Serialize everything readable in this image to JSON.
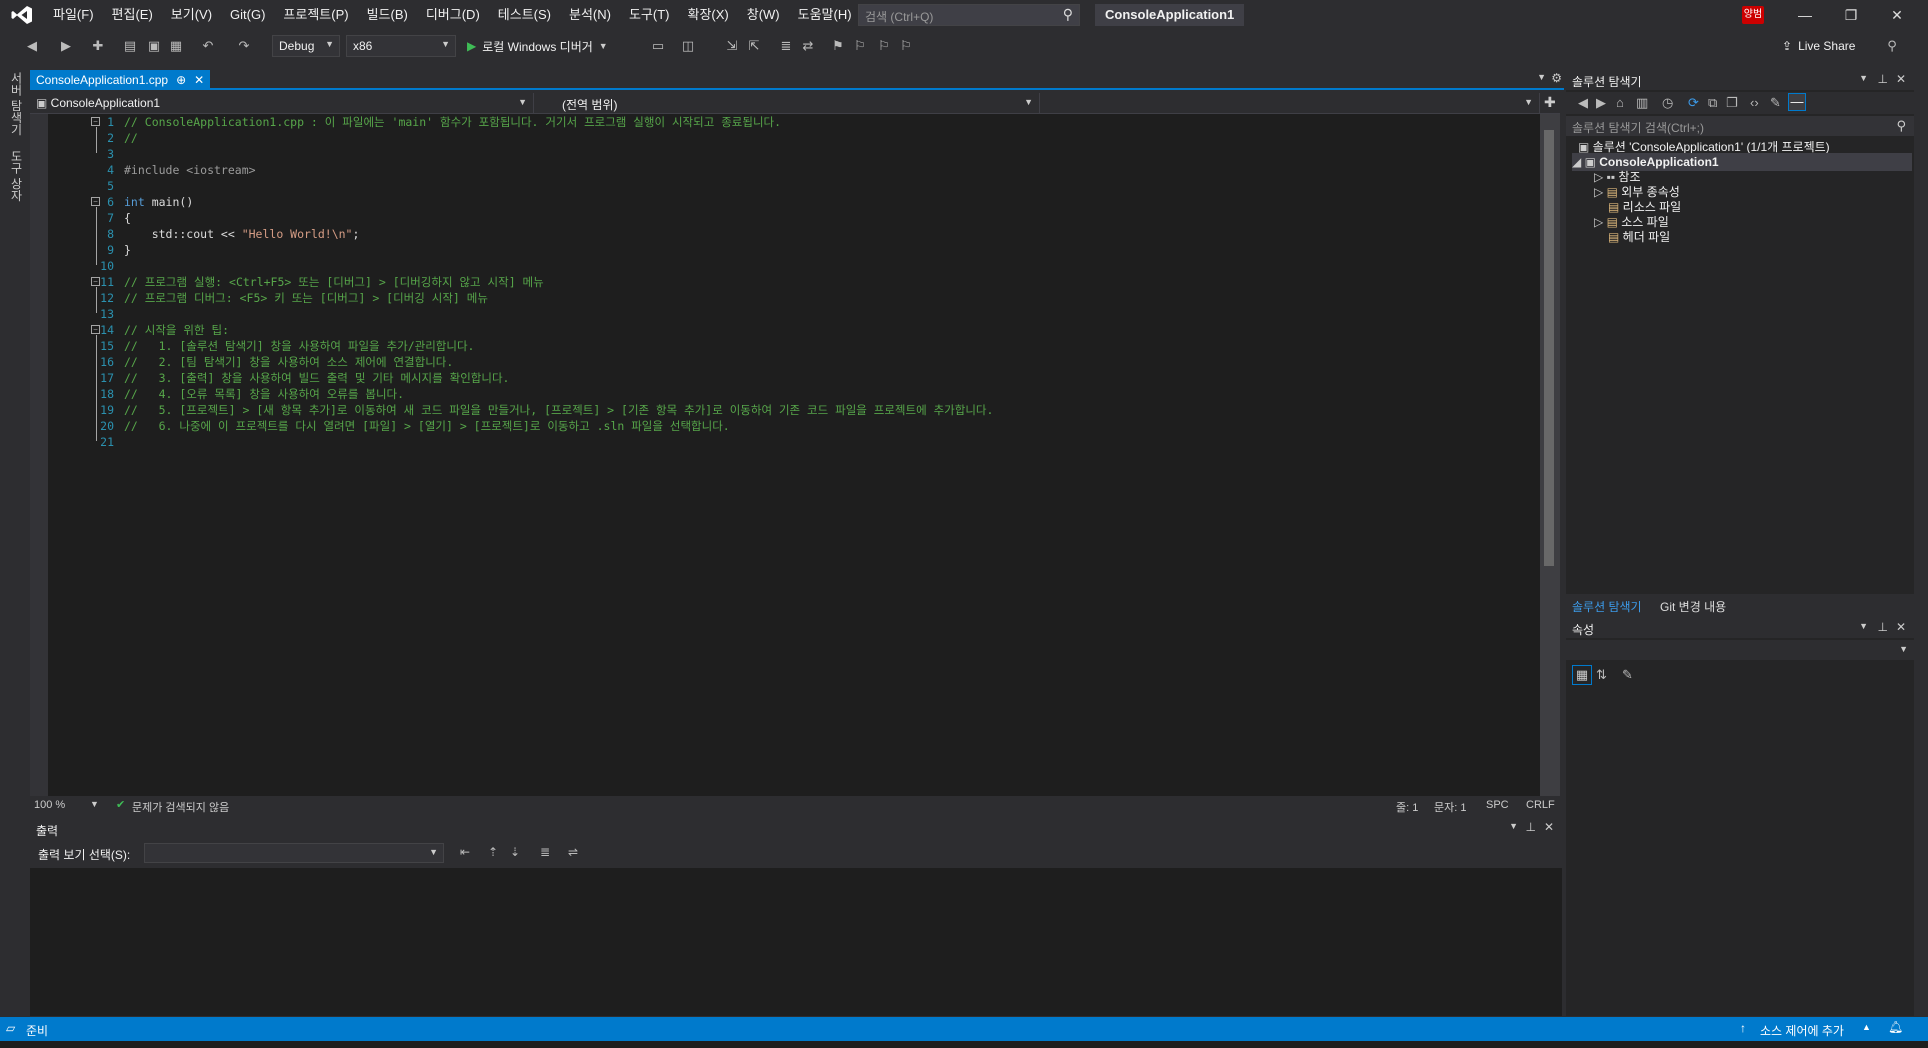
{
  "menu": [
    "파일(F)",
    "편집(E)",
    "보기(V)",
    "Git(G)",
    "프로젝트(P)",
    "빌드(B)",
    "디버그(D)",
    "테스트(S)",
    "분석(N)",
    "도구(T)",
    "확장(X)",
    "창(W)",
    "도움말(H)"
  ],
  "search": {
    "placeholder": "검색 (Ctrl+Q)"
  },
  "app_title": "ConsoleApplication1",
  "user_badge": "양범",
  "toolbar": {
    "config": "Debug",
    "platform": "x86",
    "run_label": "로컬 Windows 디버거",
    "liveshare": "Live Share"
  },
  "left_tabs": [
    "서버 탐색기",
    "도구 상자"
  ],
  "doc_tab": {
    "name": "ConsoleApplication1.cpp",
    "pin": "⊕",
    "close": "✕"
  },
  "nav": {
    "project": "ConsoleApplication1",
    "scope": "(전역 범위)"
  },
  "code": [
    {
      "n": "1",
      "text": "// ConsoleApplication1.cpp : 이 파일에는 'main' 함수가 포함됩니다. 거기서 프로그램 실행이 시작되고 종료됩니다.",
      "cls": "cmt",
      "indent": 0
    },
    {
      "n": "2",
      "text": "//",
      "cls": "cmt",
      "indent": 0
    },
    {
      "n": "3",
      "text": "",
      "cls": "plain",
      "indent": 0
    },
    {
      "n": "4",
      "text": "#include <iostream>",
      "cls": "pre",
      "indent": 0
    },
    {
      "n": "5",
      "text": "",
      "cls": "plain",
      "indent": 0
    },
    {
      "n": "6",
      "text": "int",
      "cls": "kw",
      "rest": " main()",
      "indent": 0
    },
    {
      "n": "7",
      "text": "{",
      "cls": "plain",
      "indent": 0
    },
    {
      "n": "8",
      "text": "    std::cout << ",
      "cls": "plain",
      "rest2": "\"Hello World!\\n\"",
      "tail": ";",
      "indent": 0
    },
    {
      "n": "9",
      "text": "}",
      "cls": "plain",
      "indent": 0
    },
    {
      "n": "10",
      "text": "",
      "cls": "plain",
      "indent": 0
    },
    {
      "n": "11",
      "text": "// 프로그램 실행: <Ctrl+F5> 또는 [디버그] > [디버깅하지 않고 시작] 메뉴",
      "cls": "cmt",
      "indent": 0
    },
    {
      "n": "12",
      "text": "// 프로그램 디버그: <F5> 키 또는 [디버그] > [디버깅 시작] 메뉴",
      "cls": "cmt",
      "indent": 0
    },
    {
      "n": "13",
      "text": "",
      "cls": "plain",
      "indent": 0
    },
    {
      "n": "14",
      "text": "// 시작을 위한 팁:",
      "cls": "cmt",
      "indent": 0
    },
    {
      "n": "15",
      "text": "//   1. [솔루션 탐색기] 창을 사용하여 파일을 추가/관리합니다.",
      "cls": "cmt",
      "indent": 0
    },
    {
      "n": "16",
      "text": "//   2. [팀 탐색기] 창을 사용하여 소스 제어에 연결합니다.",
      "cls": "cmt",
      "indent": 0
    },
    {
      "n": "17",
      "text": "//   3. [출력] 창을 사용하여 빌드 출력 및 기타 메시지를 확인합니다.",
      "cls": "cmt",
      "indent": 0
    },
    {
      "n": "18",
      "text": "//   4. [오류 목록] 창을 사용하여 오류를 봅니다.",
      "cls": "cmt",
      "indent": 0
    },
    {
      "n": "19",
      "text": "//   5. [프로젝트] > [새 항목 추가]로 이동하여 새 코드 파일을 만들거나, [프로젝트] > [기존 항목 추가]로 이동하여 기존 코드 파일을 프로젝트에 추가합니다.",
      "cls": "cmt",
      "indent": 0
    },
    {
      "n": "20",
      "text": "//   6. 나중에 이 프로젝트를 다시 열려면 [파일] > [열기] > [프로젝트]로 이동하고 .sln 파일을 선택합니다.",
      "cls": "cmt",
      "indent": 0
    },
    {
      "n": "21",
      "text": "",
      "cls": "plain",
      "indent": 0
    }
  ],
  "editor_status": {
    "zoom": "100 %",
    "issues": "문제가 검색되지 않음",
    "line": "줄: 1",
    "col": "문자: 1",
    "spc": "SPC",
    "crlf": "CRLF"
  },
  "output": {
    "title": "출력",
    "source_label": "출력 보기 선택(S):"
  },
  "solution": {
    "title": "솔루션 탐색기",
    "search_placeholder": "솔루션 탐색기 검색(Ctrl+;)",
    "root": "솔루션 'ConsoleApplication1' (1/1개 프로젝트)",
    "project": "ConsoleApplication1",
    "items": [
      "참조",
      "외부 종속성",
      "리소스 파일",
      "소스 파일",
      "헤더 파일"
    ],
    "tabs": [
      "솔루션 탐색기",
      "Git 변경 내용"
    ]
  },
  "properties": {
    "title": "속성"
  },
  "status": {
    "ready": "준비",
    "source_control": "소스 제어에 추가"
  },
  "colors": {
    "accent": "#007acc",
    "comment": "#57a64a",
    "keyword": "#569cd6",
    "string": "#d69d85"
  }
}
